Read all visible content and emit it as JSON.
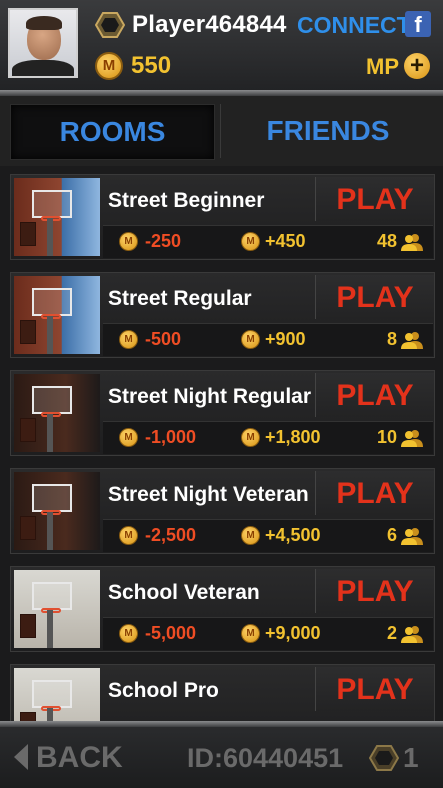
{
  "header": {
    "player_name": "Player464844",
    "connect_label": "CONNECT",
    "facebook_glyph": "f",
    "coins": "550",
    "mp_label": "MP",
    "plus_glyph": "+",
    "coin_glyph": "M"
  },
  "tabs": {
    "rooms": "ROOMS",
    "friends": "FRIENDS",
    "active": "rooms"
  },
  "rooms": [
    {
      "name": "Street Beginner",
      "play": "PLAY",
      "cost": "-250",
      "reward": "+450",
      "players": "48",
      "scene": "street-day"
    },
    {
      "name": "Street Regular",
      "play": "PLAY",
      "cost": "-500",
      "reward": "+900",
      "players": "8",
      "scene": "street-day"
    },
    {
      "name": "Street Night Regular",
      "play": "PLAY",
      "cost": "-1,000",
      "reward": "+1,800",
      "players": "10",
      "scene": "street-night"
    },
    {
      "name": "Street Night Veteran",
      "play": "PLAY",
      "cost": "-2,500",
      "reward": "+4,500",
      "players": "6",
      "scene": "street-night"
    },
    {
      "name": "School Veteran",
      "play": "PLAY",
      "cost": "-5,000",
      "reward": "+9,000",
      "players": "2",
      "scene": "school"
    },
    {
      "name": "School Pro",
      "play": "PLAY",
      "cost": "",
      "reward": "",
      "players": "",
      "scene": "school"
    }
  ],
  "footer": {
    "back_label": "BACK",
    "player_id": "ID:60440451",
    "rank": "1"
  },
  "colors": {
    "accent_blue": "#2f8fea",
    "gold": "#f2c230",
    "play_red": "#e3321b",
    "cost_red": "#ef4d24"
  }
}
